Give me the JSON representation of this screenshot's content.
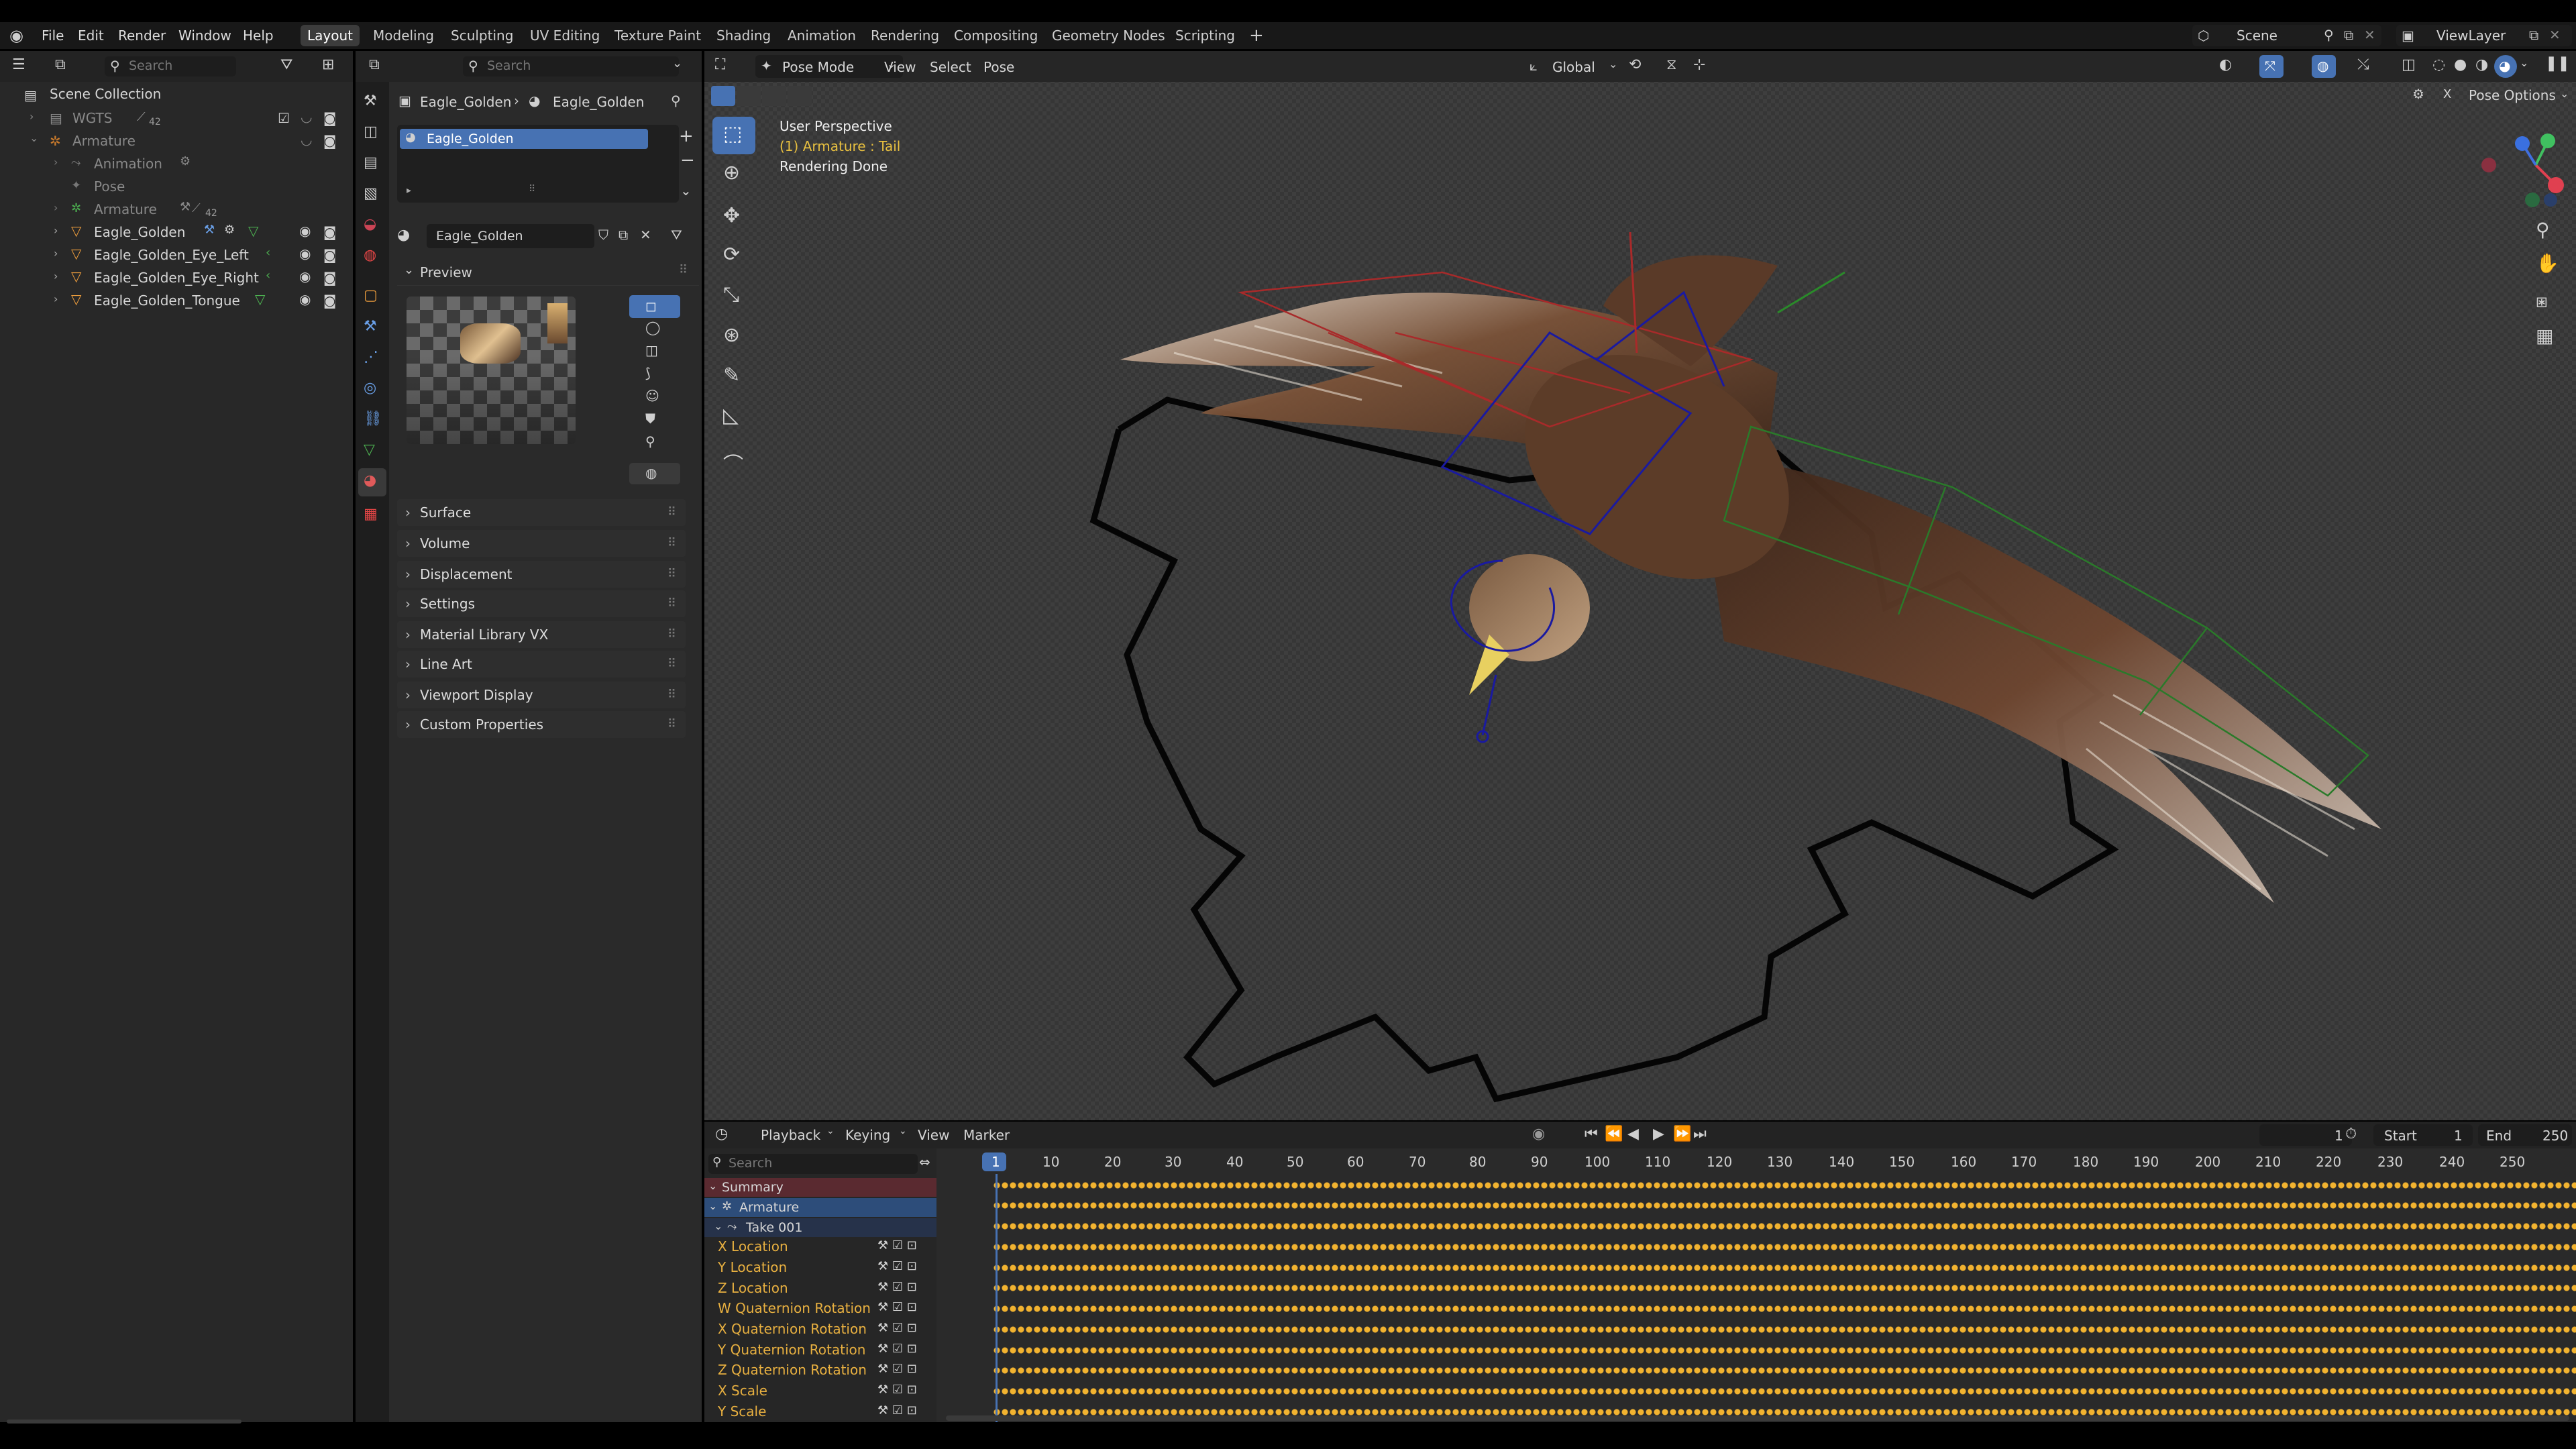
{
  "menu": {
    "file": "File",
    "edit": "Edit",
    "render": "Render",
    "window": "Window",
    "help": "Help"
  },
  "workspaces": [
    "Layout",
    "Modeling",
    "Sculpting",
    "UV Editing",
    "Texture Paint",
    "Shading",
    "Animation",
    "Rendering",
    "Compositing",
    "Geometry Nodes",
    "Scripting"
  ],
  "scene": {
    "label": "Scene",
    "viewlayer": "ViewLayer"
  },
  "outliner": {
    "search_placeholder": "Search",
    "root": "Scene Collection",
    "items": [
      {
        "label": "WGTS",
        "badge": "42"
      },
      {
        "label": "Armature"
      },
      {
        "label": "Animation"
      },
      {
        "label": "Pose"
      },
      {
        "label": "Armature",
        "badge": "42"
      },
      {
        "label": "Eagle_Golden"
      },
      {
        "label": "Eagle_Golden_Eye_Left"
      },
      {
        "label": "Eagle_Golden_Eye_Right"
      },
      {
        "label": "Eagle_Golden_Tongue"
      }
    ]
  },
  "properties": {
    "search_placeholder": "Search",
    "breadcrumb": [
      "Eagle_Golden",
      "Eagle_Golden"
    ],
    "slot": "Eagle_Golden",
    "material": "Eagle_Golden",
    "preview": "Preview",
    "sections": [
      "Surface",
      "Volume",
      "Displacement",
      "Settings",
      "Material Library VX",
      "Line Art",
      "Viewport Display",
      "Custom Properties"
    ]
  },
  "viewport": {
    "mode": "Pose Mode",
    "menus": [
      "View",
      "Select",
      "Pose"
    ],
    "orientation": "Global",
    "pose_options": "Pose Options",
    "overlay": [
      "User Perspective",
      "(1) Armature : Tail",
      "Rendering Done"
    ],
    "x_label": "X"
  },
  "timeline": {
    "menus": [
      "Playback",
      "Keying",
      "View",
      "Marker"
    ],
    "current": "1",
    "start_label": "Start",
    "start": "1",
    "end_label": "End",
    "end": "250",
    "search_placeholder": "Search",
    "ticks": [
      "1",
      "10",
      "20",
      "30",
      "40",
      "50",
      "60",
      "70",
      "80",
      "90",
      "100",
      "110",
      "120",
      "130",
      "140",
      "150",
      "160",
      "170",
      "180",
      "190",
      "200",
      "210",
      "220",
      "230",
      "240",
      "250"
    ],
    "summary": "Summary",
    "armature": "Armature",
    "action": "Take 001",
    "channels": [
      "X Location",
      "Y Location",
      "Z Location",
      "W Quaternion Rotation",
      "X Quaternion Rotation",
      "Y Quaternion Rotation",
      "Z Quaternion Rotation",
      "X Scale",
      "Y Scale"
    ]
  },
  "colors": {
    "accent": "#4772b3",
    "keyframe": "#f2b330",
    "channel": "#e8b040"
  }
}
